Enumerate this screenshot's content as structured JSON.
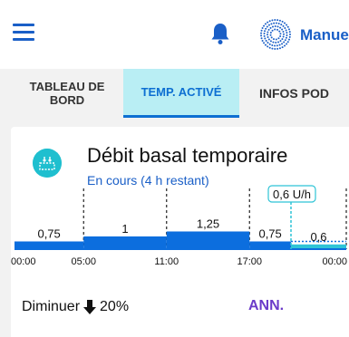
{
  "header": {
    "menu_icon": "menu-icon",
    "bell_icon": "bell-icon",
    "avatar_icon": "avatar-icon",
    "user_name": "Manuel"
  },
  "tabs": [
    {
      "label": "TABLEAU DE BORD",
      "active": false
    },
    {
      "label": "TEMP. ACTIVÉ",
      "active": true
    },
    {
      "label": "INFOS POD",
      "active": false
    }
  ],
  "card": {
    "icon": "temp-basal-icon",
    "title": "Débit basal temporaire",
    "subtitle": "En cours (4 h restant)",
    "current_marker": "0,6 U/h",
    "action_text": "Diminuer",
    "action_percent": "20%",
    "action_icon": "arrow-down-icon",
    "cancel_label": "ANN."
  },
  "chart_data": {
    "type": "step",
    "x_ticks": [
      "00:00",
      "05:00",
      "11:00",
      "17:00",
      "00:00"
    ],
    "segments": [
      {
        "start": 0,
        "end": 5,
        "value": 0.75,
        "label": "0,75"
      },
      {
        "start": 5,
        "end": 11,
        "value": 1,
        "label": "1"
      },
      {
        "start": 11,
        "end": 17,
        "value": 1.25,
        "label": "1,25"
      },
      {
        "start": 17,
        "end": 20,
        "value": 0.75,
        "label": "0,75"
      },
      {
        "start": 20,
        "end": 24,
        "value": 0.6,
        "label": "0,6",
        "temporary": true
      }
    ],
    "current_time": 20,
    "colors": {
      "basal": "#0c6ede",
      "temp": "#2fc4d6"
    }
  }
}
